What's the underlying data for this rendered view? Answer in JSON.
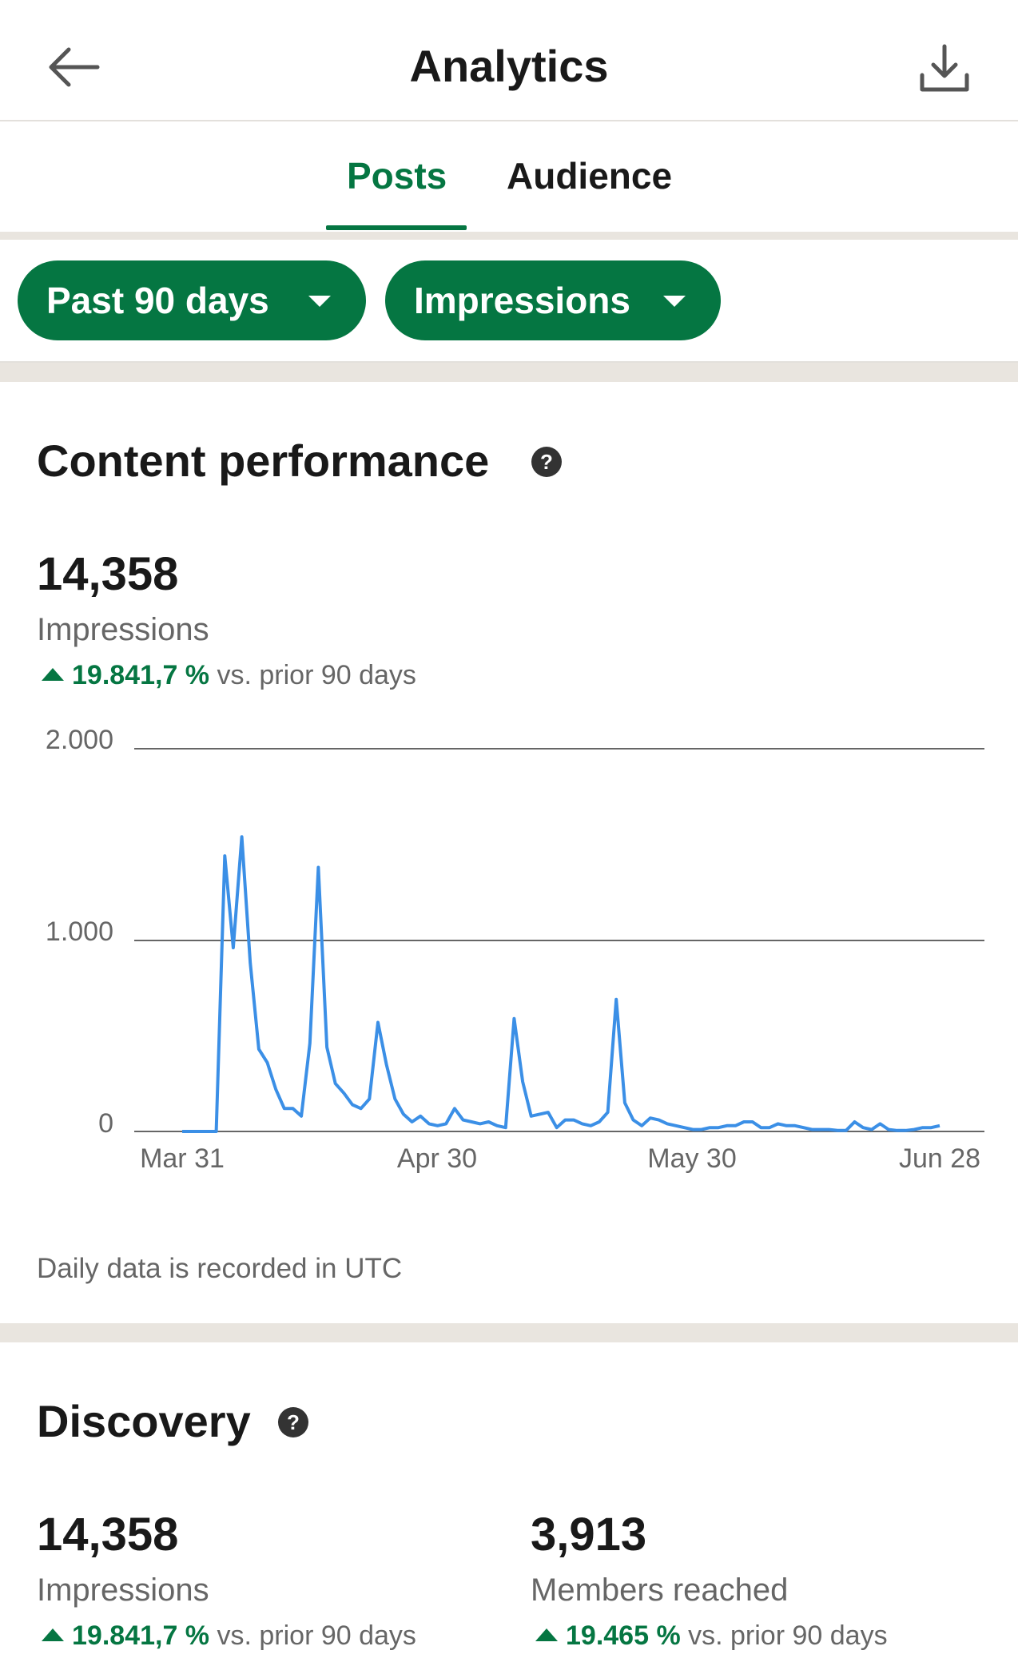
{
  "header": {
    "title": "Analytics",
    "back_icon": "arrow-left-icon",
    "download_icon": "download-icon"
  },
  "tabs": [
    {
      "label": "Posts",
      "active": true
    },
    {
      "label": "Audience",
      "active": false
    }
  ],
  "filters": {
    "range": "Past 90 days",
    "metric": "Impressions"
  },
  "colors": {
    "accent": "#057642",
    "line": "#3b8fe6",
    "divider": "#e9e5df"
  },
  "content_performance": {
    "title": "Content performance",
    "value": "14,358",
    "label": "Impressions",
    "change_pct": "19.841,7 %",
    "change_suffix": "vs. prior 90 days",
    "footnote": "Daily data is recorded in UTC"
  },
  "chart_data": {
    "type": "line",
    "x_tick_labels": [
      "Mar 31",
      "Apr 30",
      "May 30",
      "Jun 28"
    ],
    "y_tick_labels": [
      "2.000",
      "1.000",
      "0"
    ],
    "ylim": [
      0,
      2000
    ],
    "grid": true,
    "series": [
      {
        "values": [
          0,
          0,
          0,
          0,
          0,
          1440,
          960,
          1540,
          880,
          430,
          360,
          220,
          120,
          120,
          80,
          460,
          1380,
          440,
          250,
          200,
          140,
          120,
          170,
          570,
          350,
          170,
          90,
          50,
          80,
          40,
          30,
          40,
          120,
          60,
          50,
          40,
          50,
          30,
          20,
          590,
          260,
          80,
          90,
          100,
          20,
          60,
          60,
          40,
          30,
          50,
          100,
          690,
          150,
          60,
          30,
          70,
          60,
          40,
          30,
          20,
          10,
          10,
          20,
          20,
          30,
          30,
          50,
          50,
          20,
          20,
          40,
          30,
          30,
          20,
          10,
          10,
          10,
          5,
          5,
          50,
          20,
          10,
          40,
          10,
          5,
          5,
          10,
          20,
          20,
          30
        ]
      }
    ]
  },
  "discovery": {
    "title": "Discovery",
    "impressions_value": "14,358",
    "impressions_label": "Impressions",
    "impressions_change_pct": "19.841,7 %",
    "impressions_change_suffix": "vs. prior 90 days",
    "members_value": "3,913",
    "members_label": "Members reached",
    "members_change_pct": "19.465 %",
    "members_change_suffix": "vs. prior 90 days"
  }
}
